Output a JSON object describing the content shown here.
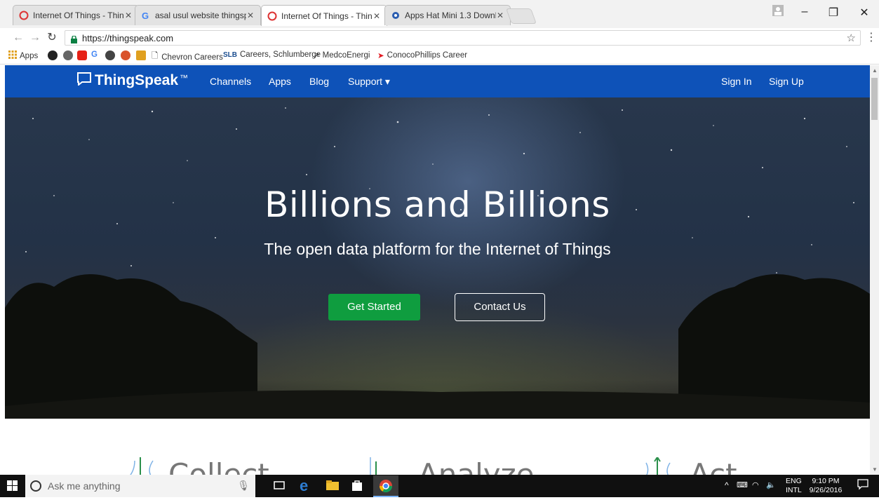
{
  "browser": {
    "tabs": [
      {
        "title": "Internet Of Things - Thin",
        "icon": "thingspeak-icon"
      },
      {
        "title": "asal usul website thingsp",
        "icon": "google-icon"
      },
      {
        "title": "Internet Of Things - Thin",
        "icon": "thingspeak-icon",
        "active": true
      },
      {
        "title": "Apps Hat Mini 1.3 Downl",
        "icon": "blue-dot-icon"
      }
    ],
    "url": "https://thingspeak.com",
    "bookmarks": [
      {
        "label": "Apps"
      },
      {
        "label": "Chevron Careers"
      },
      {
        "label": "Careers, Schlumberge"
      },
      {
        "label": "MedcoEnergi"
      },
      {
        "label": "ConocoPhillips Career"
      }
    ]
  },
  "site": {
    "logo": "ThingSpeak",
    "logo_tm": "™",
    "nav": {
      "channels": "Channels",
      "apps": "Apps",
      "blog": "Blog",
      "support": "Support ▾",
      "sign_in": "Sign In",
      "sign_up": "Sign Up"
    },
    "hero": {
      "title": "Billions and Billions",
      "subtitle": "The open data platform for the Internet of Things",
      "get_started": "Get Started",
      "contact_us": "Contact Us"
    },
    "features": [
      "Collect",
      "Analyze",
      "Act"
    ]
  },
  "taskbar": {
    "search_placeholder": "Ask me anything",
    "lang": "ENG",
    "layout": "INTL",
    "time": "9:10 PM",
    "date": "9/26/2016"
  },
  "colors": {
    "nav_blue": "#0e52b8",
    "button_green": "#0f9d3f"
  }
}
